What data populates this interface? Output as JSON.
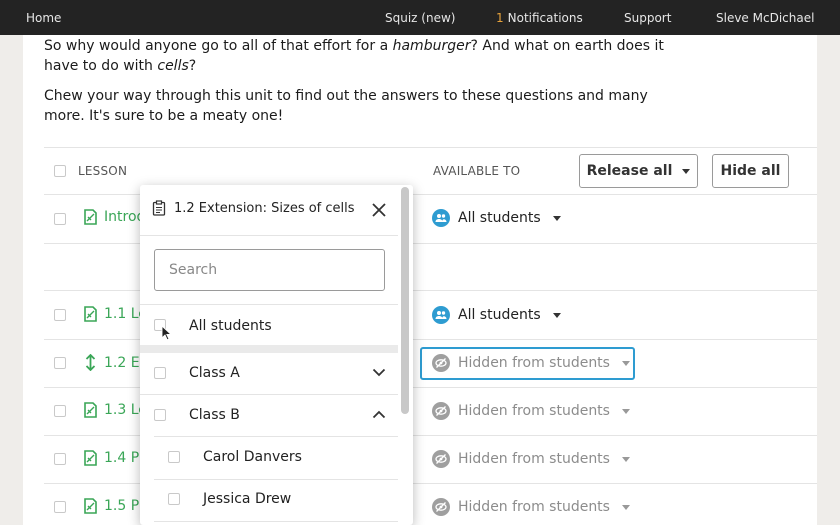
{
  "topbar": {
    "home": "Home",
    "squiz": "Squiz (new)",
    "notifications_count": "1",
    "notifications": "Notifications",
    "support": "Support",
    "user": "Sleve McDichael"
  },
  "intro": {
    "p1_a": "So why would anyone go to all of that effort for a ",
    "p1_em": "hamburger",
    "p1_b": "? And what on earth does it have to do with ",
    "p1_em2": "cells",
    "p1_c": "?",
    "p2": "Chew your way through this unit to find out the answers to these questions and many more. It's sure to be a meaty one!"
  },
  "table": {
    "col_lesson": "LESSON",
    "col_available": "AVAILABLE TO",
    "release_all": "Release all",
    "hide_all": "Hide all",
    "rows": [
      {
        "label": "Introd",
        "available": "All students",
        "state": "on"
      },
      {
        "label": "1.1 Le",
        "available": "All students",
        "state": "on"
      },
      {
        "label": "1.2 Ex",
        "available": "Hidden from students",
        "state": "off"
      },
      {
        "label": "1.3 Le",
        "available": "Hidden from students",
        "state": "off"
      },
      {
        "label": "1.4 Pr",
        "available": "Hidden from students",
        "state": "off"
      },
      {
        "label": "1.5 Pr",
        "available": "Hidden from students",
        "state": "off"
      }
    ]
  },
  "popup": {
    "title": "1.2 Extension: Sizes of cells",
    "search_placeholder": "Search",
    "all_students": "All students",
    "class_a": "Class A",
    "class_b": "Class B",
    "students": [
      "Carol Danvers",
      "Jessica Drew"
    ]
  },
  "colors": {
    "accent": "#2e9cd1",
    "lesson_green": "#3aa657",
    "topbar": "#232323",
    "badge": "#e6a23c"
  },
  "icons": {
    "lesson_doc": "lesson-document-icon",
    "drag": "drag-handle-icon",
    "students": "students-group-icon",
    "hidden": "eye-slash-icon",
    "clipboard": "clipboard-icon",
    "close": "close-icon"
  }
}
